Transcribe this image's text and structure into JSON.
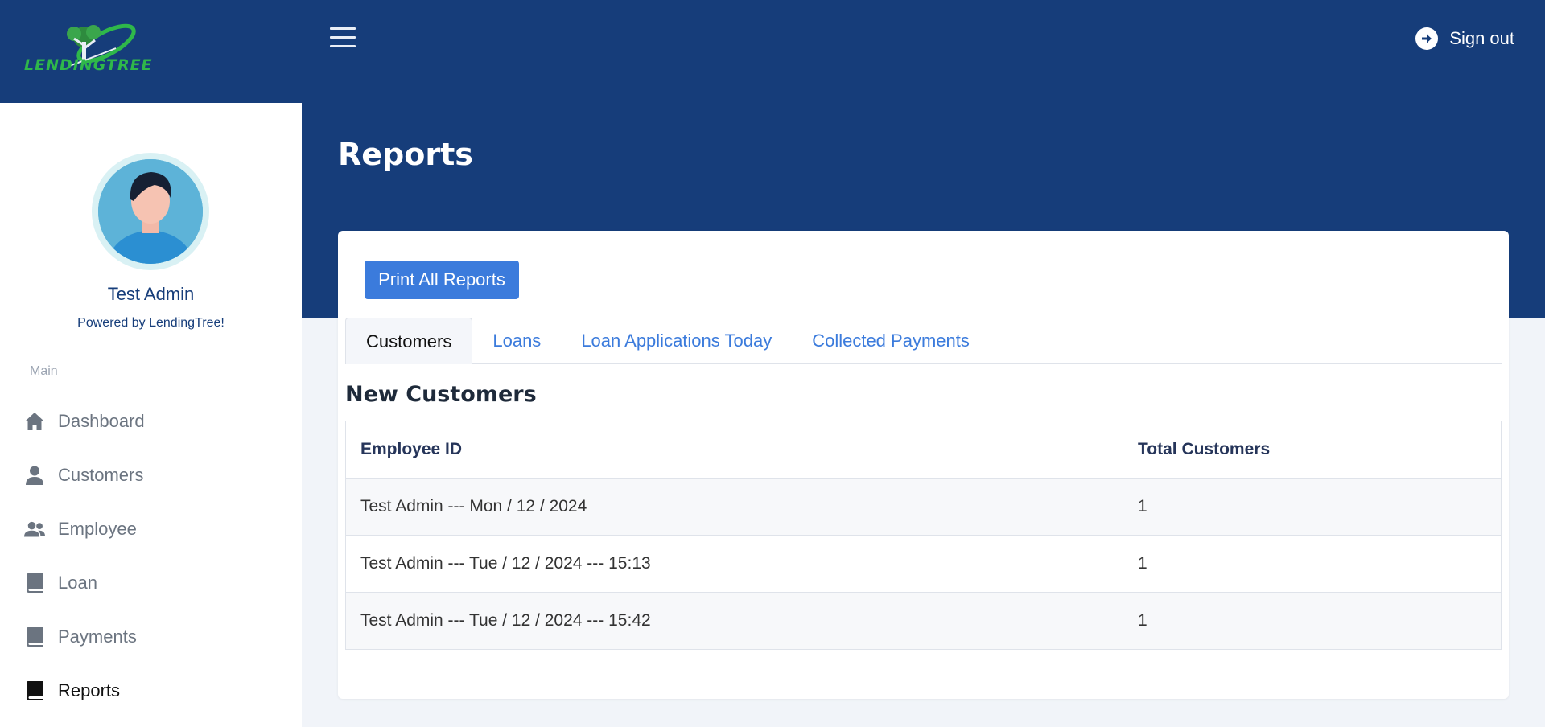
{
  "brand": {
    "logo_text": "LENDINGTREE"
  },
  "user": {
    "name": "Test Admin",
    "subtitle": "Powered by LendingTree!"
  },
  "sidebar": {
    "section_label": "Main",
    "items": [
      {
        "label": "Dashboard",
        "icon": "home-icon",
        "active": false
      },
      {
        "label": "Customers",
        "icon": "user-icon",
        "active": false
      },
      {
        "label": "Employee",
        "icon": "users-icon",
        "active": false
      },
      {
        "label": "Loan",
        "icon": "book-icon",
        "active": false
      },
      {
        "label": "Payments",
        "icon": "book-icon",
        "active": false
      },
      {
        "label": "Reports",
        "icon": "book-icon",
        "active": true
      }
    ]
  },
  "header": {
    "signout_label": "Sign out",
    "menu_icon": "hamburger-icon"
  },
  "page": {
    "title": "Reports"
  },
  "card": {
    "print_label": "Print All Reports",
    "tabs": [
      {
        "label": "Customers",
        "active": true
      },
      {
        "label": "Loans",
        "active": false
      },
      {
        "label": "Loan Applications Today",
        "active": false
      },
      {
        "label": "Collected Payments",
        "active": false
      }
    ],
    "section_title": "New Customers",
    "table": {
      "headers": [
        "Employee ID",
        "Total Customers"
      ],
      "rows": [
        [
          "Test Admin --- Mon / 12 / 2024",
          "1"
        ],
        [
          "Test Admin --- Tue / 12 / 2024 --- 15:13",
          "1"
        ],
        [
          "Test Admin --- Tue / 12 / 2024 --- 15:42",
          "1"
        ]
      ]
    }
  },
  "colors": {
    "primary": "#163d7a",
    "accent": "#3b7bdc",
    "logo_green": "#2fb84a"
  }
}
